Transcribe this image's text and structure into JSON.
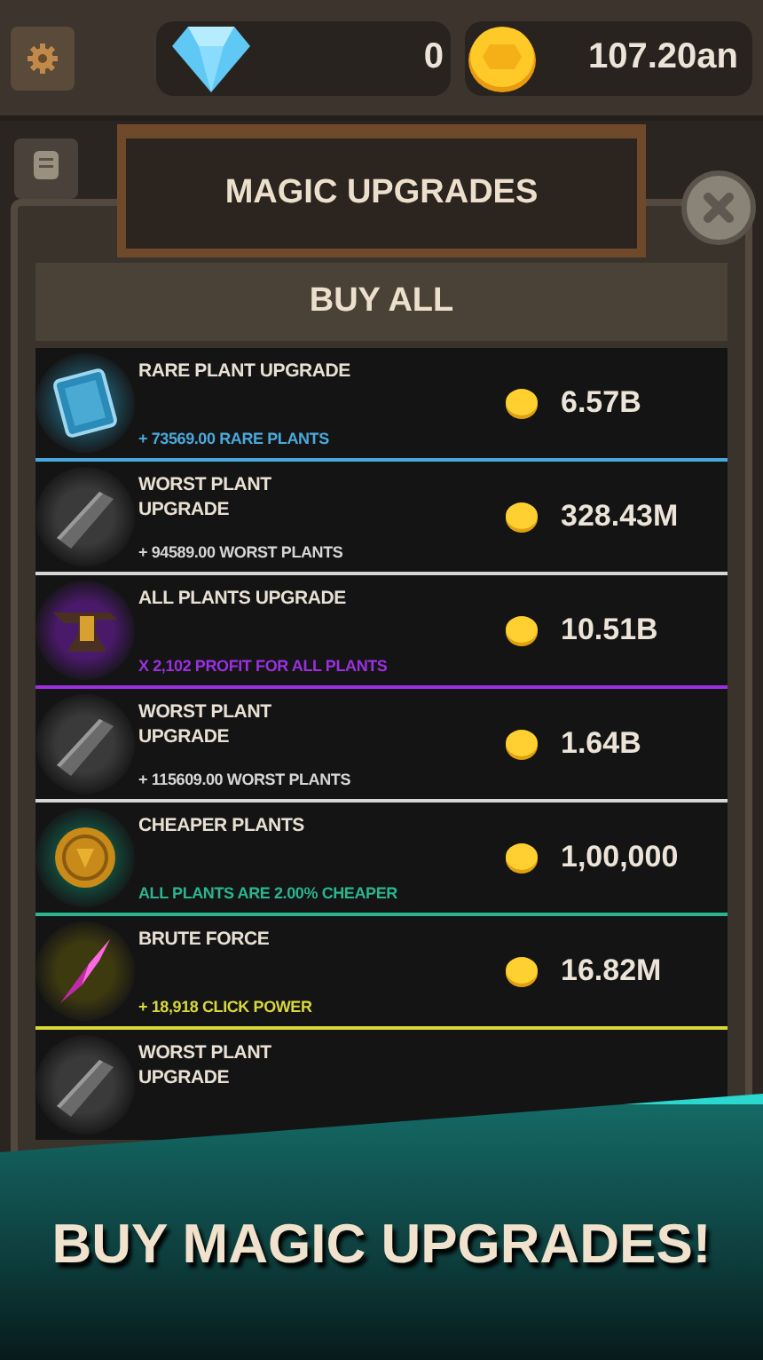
{
  "top_bar": {
    "gems": "0",
    "coins": "107.20an"
  },
  "panel": {
    "title": "MAGIC UPGRADES",
    "buy_all": "BUY ALL"
  },
  "upgrades": [
    {
      "kind": "card",
      "name": "RARE PLANT UPGRADE",
      "effect": "+ 73569.00 RARE PLANTS",
      "price": "6.57B",
      "color": "#49a9dc"
    },
    {
      "kind": "ingot",
      "name": "WORST PLANT UPGRADE",
      "effect": "+ 94589.00 WORST PLANTS",
      "price": "328.43M",
      "color": "#d6d6d6"
    },
    {
      "kind": "anvil",
      "name": "ALL PLANTS UPGRADE",
      "effect": "X 2,102 PROFIT FOR ALL PLANTS",
      "price": "10.51B",
      "color": "#9b30e0"
    },
    {
      "kind": "ingot",
      "name": "WORST PLANT UPGRADE",
      "effect": "+ 115609.00 WORST PLANTS",
      "price": "1.64B",
      "color": "#d6d6d6"
    },
    {
      "kind": "coin",
      "name": "CHEAPER PLANTS",
      "effect": "ALL PLANTS ARE 2.00% CHEAPER",
      "price": "1,00,000",
      "color": "#2bb48e"
    },
    {
      "kind": "crystal",
      "name": "BRUTE FORCE",
      "effect": "+ 18,918 CLICK POWER",
      "price": "16.82M",
      "color": "#d8d83a"
    },
    {
      "kind": "ingot",
      "name": "WORST PLANT UPGRADE"
    }
  ],
  "banner": {
    "text": "BUY MAGIC UPGRADES!"
  }
}
